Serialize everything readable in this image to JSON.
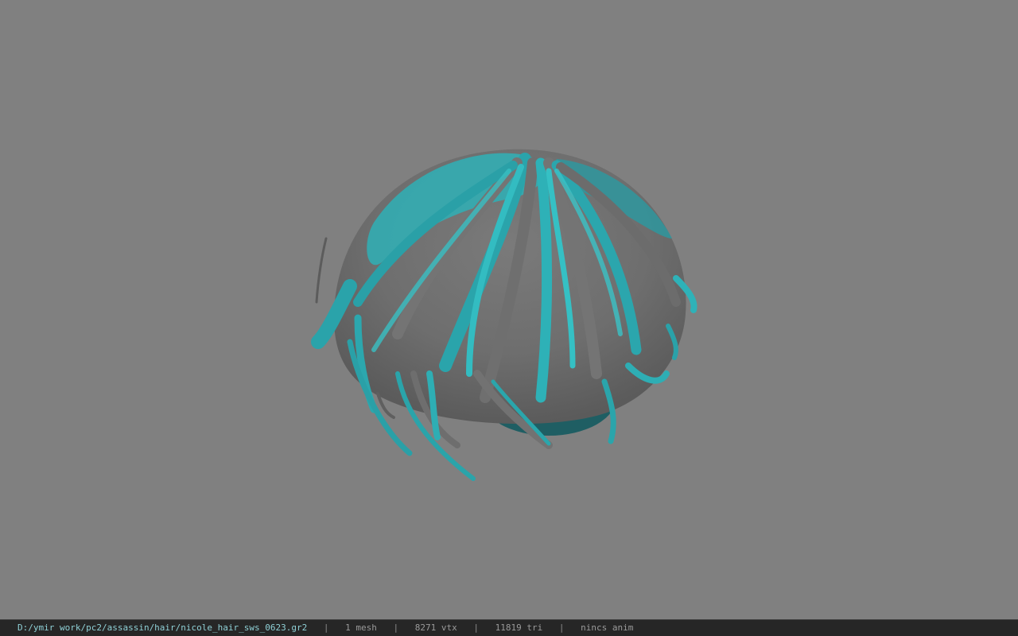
{
  "viewport": {
    "background_color": "#808080",
    "model_colors": {
      "teal": "#2ea7ad",
      "teal_light": "#3cc4c8",
      "teal_dark": "#1c6f76",
      "grey": "#737373",
      "grey_dark": "#5a5a5a"
    }
  },
  "statusbar": {
    "file_path": "D:/ymir work/pc2/assassin/hair/nicole_hair_sws_0623.gr2",
    "separator": "|",
    "mesh_count": "1 mesh",
    "vertex_count": "8271 vtx",
    "triangle_count": "11819 tri",
    "anim_status": "nincs anim"
  }
}
